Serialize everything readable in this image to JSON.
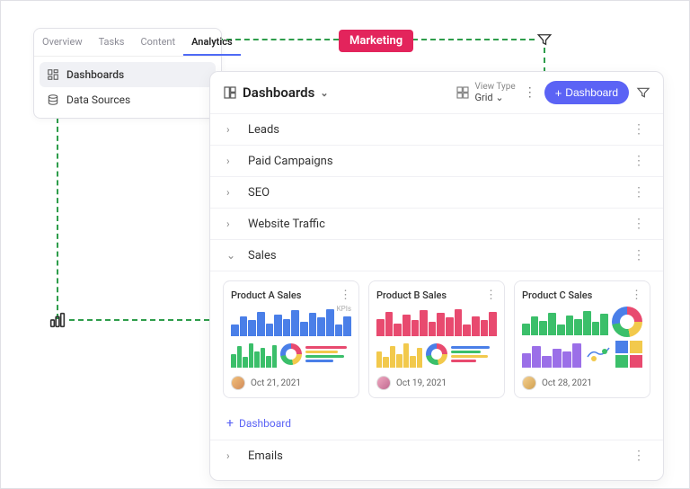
{
  "tag": "Marketing",
  "tabs": {
    "items": [
      "Overview",
      "Tasks",
      "Content",
      "Analytics"
    ],
    "activeIndex": 3,
    "sub": [
      {
        "label": "Dashboards",
        "icon": "dashboard-icon"
      },
      {
        "label": "Data Sources",
        "icon": "database-icon"
      }
    ],
    "subActiveIndex": 0
  },
  "panel": {
    "title": "Dashboards",
    "viewType": {
      "label": "View Type",
      "value": "Grid"
    },
    "primaryButton": "Dashboard",
    "rows": [
      {
        "label": "Leads",
        "expanded": false
      },
      {
        "label": "Paid Campaigns",
        "expanded": false
      },
      {
        "label": "SEO",
        "expanded": false
      },
      {
        "label": "Website Traffic",
        "expanded": false
      },
      {
        "label": "Sales",
        "expanded": true
      },
      {
        "label": "Emails",
        "expanded": false
      }
    ],
    "cards": [
      {
        "title": "Product A Sales",
        "date": "Oct 21, 2021",
        "kpi": "KPIs"
      },
      {
        "title": "Product B Sales",
        "date": "Oct 19, 2021"
      },
      {
        "title": "Product C Sales",
        "date": "Oct 28, 2021"
      }
    ],
    "addLabel": "Dashboard"
  }
}
